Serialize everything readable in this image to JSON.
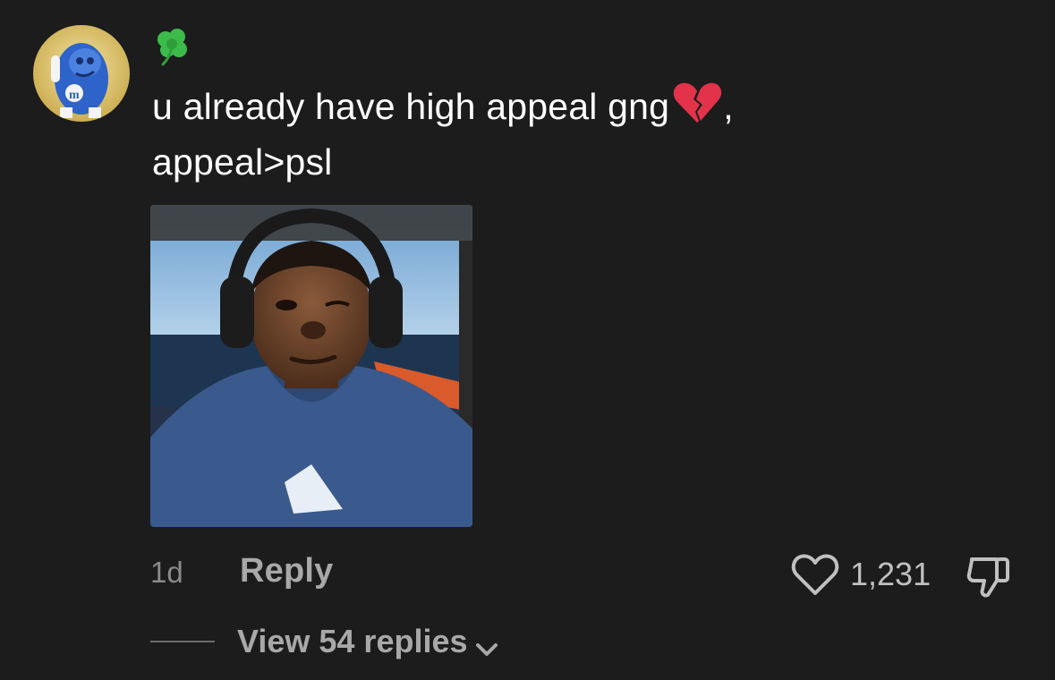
{
  "comment": {
    "username_emoji": "☘️",
    "text_line1": "u already have high appeal gng",
    "text_line1_suffix": ",",
    "text_line2": "appeal>psl",
    "heart_emoji": "broken-heart-icon",
    "timestamp": "1d",
    "reply_label": "Reply",
    "like_count": "1,231",
    "view_replies_label": "View 54 replies"
  },
  "icons": {
    "avatar": "m-and-m-avatar",
    "username": "shamrock-icon",
    "like": "heart-outline-icon",
    "dislike": "thumbs-down-icon",
    "expand": "chevron-down-icon"
  },
  "colors": {
    "background": "#1c1c1c",
    "text_primary": "#ffffff",
    "text_secondary": "#a8a8a8",
    "text_muted": "#8a8a8a"
  }
}
